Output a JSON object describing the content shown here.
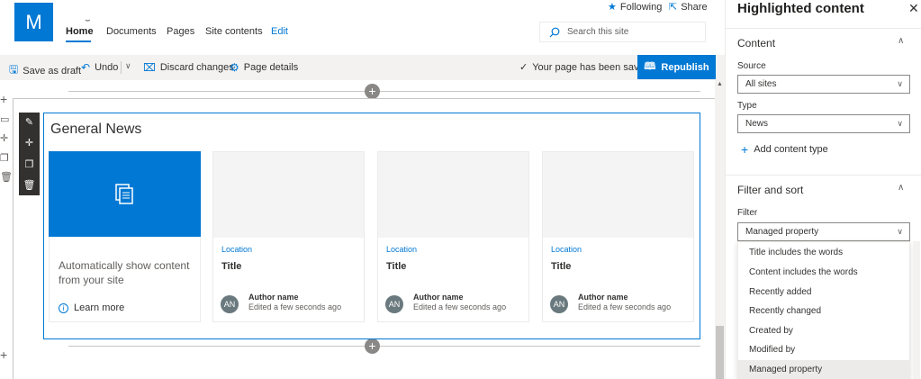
{
  "site": {
    "logo_letter": "M",
    "nav": [
      "Home",
      "Documents",
      "Pages",
      "Site contents",
      "Edit"
    ],
    "following": "Following",
    "share": "Share",
    "search_placeholder": "Search this site"
  },
  "commandbar": {
    "save_draft": "Save as draft",
    "undo": "Undo",
    "discard": "Discard changes",
    "page_details": "Page details",
    "saved_status": "Your page has been saved",
    "republish": "Republish"
  },
  "webpart": {
    "title": "General News",
    "auto_text": "Automatically show content from your site",
    "learn_more": "Learn more",
    "cards": [
      {
        "location": "Location",
        "title": "Title",
        "initials": "AN",
        "author": "Author name",
        "edited": "Edited a few seconds ago"
      },
      {
        "location": "Location",
        "title": "Title",
        "initials": "AN",
        "author": "Author name",
        "edited": "Edited a few seconds ago"
      },
      {
        "location": "Location",
        "title": "Title",
        "initials": "AN",
        "author": "Author name",
        "edited": "Edited a few seconds ago"
      }
    ]
  },
  "panel": {
    "title": "Highlighted content",
    "content_section": "Content",
    "source_label": "Source",
    "source_value": "All sites",
    "type_label": "Type",
    "type_value": "News",
    "add_content_type": "Add content type",
    "filter_section": "Filter and sort",
    "filter_label": "Filter",
    "filter_value": "Managed property",
    "filter_options": [
      "Title includes the words",
      "Content includes the words",
      "Recently added",
      "Recently changed",
      "Created by",
      "Modified by",
      "Managed property"
    ],
    "selected_option": "Managed property"
  },
  "colors": {
    "accent": "#0078d4",
    "command_bar": "#f3f2f1",
    "toolbar": "#323130"
  }
}
